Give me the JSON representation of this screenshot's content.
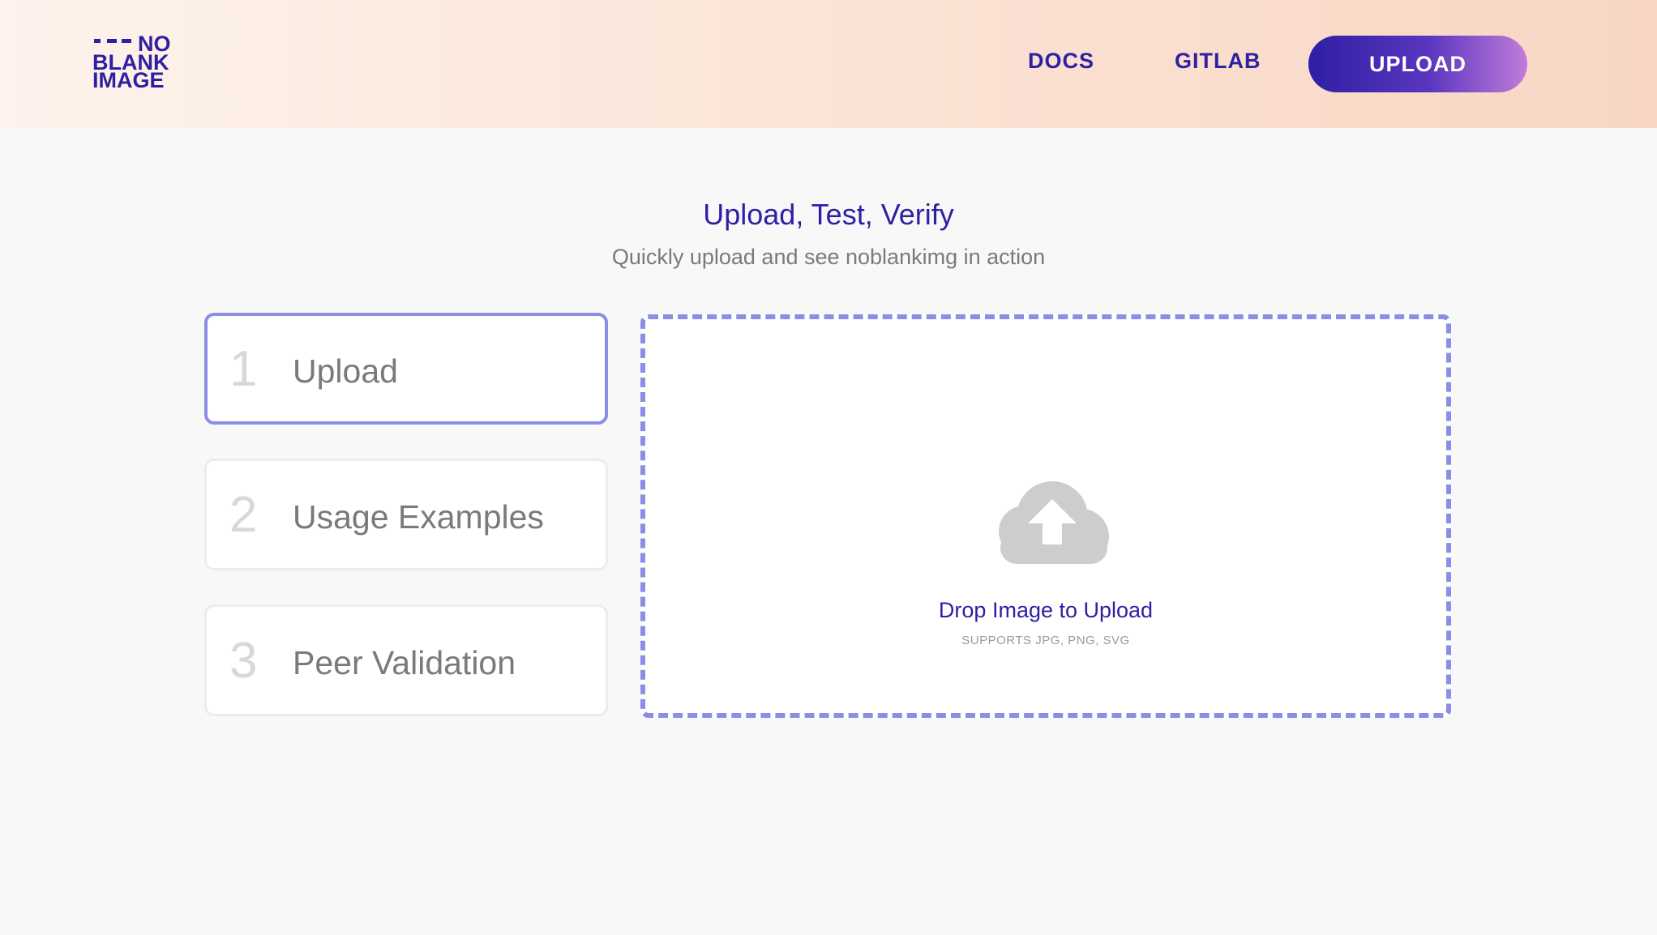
{
  "header": {
    "logo": {
      "line1": "NO",
      "line2": "BLANK",
      "line3": "IMAGE"
    },
    "nav": {
      "docs": "DOCS",
      "gitlab": "GITLAB",
      "upload": "UPLOAD"
    },
    "colors": {
      "brand": "#2e1fa3",
      "accent_gradient_end": "#c17cd9"
    }
  },
  "main": {
    "title": "Upload, Test, Verify",
    "subtitle": "Quickly upload and see noblankimg in action",
    "steps": [
      {
        "number": "1",
        "label": "Upload",
        "active": true
      },
      {
        "number": "2",
        "label": "Usage Examples",
        "active": false
      },
      {
        "number": "3",
        "label": "Peer Validation",
        "active": false
      }
    ],
    "dropzone": {
      "icon": "cloud-upload-icon",
      "title": "Drop Image to Upload",
      "supported": "SUPPORTS JPG, PNG, SVG",
      "border_color": "#8b8de6"
    }
  }
}
